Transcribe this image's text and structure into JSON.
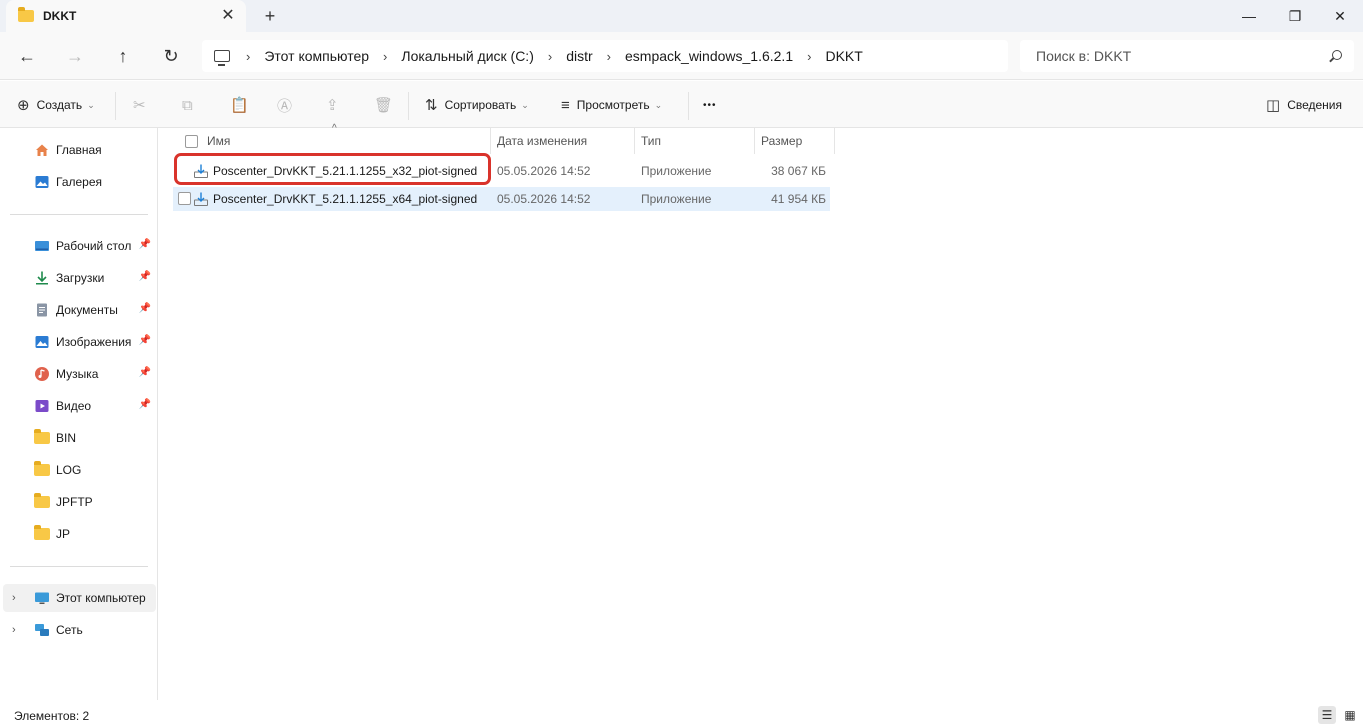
{
  "window": {
    "tab_title": "DKKT",
    "new_tab_glyph": "+",
    "close_tab_glyph": "✕",
    "minimize_glyph": "—",
    "restore_glyph": "❐",
    "close_glyph": "✕"
  },
  "address": {
    "back_glyph": "←",
    "forward_glyph": "→",
    "up_glyph": "↑",
    "refresh_glyph": "↻",
    "separator": "›",
    "crumbs": [
      "Этот компьютер",
      "Локальный диск (C:)",
      "distr",
      "esmpack_windows_1.6.2.1",
      "DKKT"
    ],
    "search_placeholder": "Поиск в: DKKT"
  },
  "toolbar": {
    "create_label": "Создать",
    "sort_label": "Сортировать",
    "view_label": "Просмотреть",
    "more_glyph": "•••",
    "details_label": "Сведения",
    "caret_glyph": "⌄"
  },
  "sidebar": {
    "top_items": [
      {
        "label": "Главная",
        "icon": "home-icon"
      },
      {
        "label": "Галерея",
        "icon": "gallery-icon"
      }
    ],
    "pinned_items": [
      {
        "label": "Рабочий стол",
        "icon": "desktop-icon",
        "pinned": true
      },
      {
        "label": "Загрузки",
        "icon": "downloads-icon",
        "pinned": true
      },
      {
        "label": "Документы",
        "icon": "documents-icon",
        "pinned": true
      },
      {
        "label": "Изображения",
        "icon": "pictures-icon",
        "pinned": true
      },
      {
        "label": "Музыка",
        "icon": "music-icon",
        "pinned": true
      },
      {
        "label": "Видео",
        "icon": "videos-icon",
        "pinned": true
      },
      {
        "label": "BIN",
        "icon": "folder-icon",
        "pinned": false
      },
      {
        "label": "LOG",
        "icon": "folder-icon",
        "pinned": false
      },
      {
        "label": "JPFTP",
        "icon": "folder-icon",
        "pinned": false
      },
      {
        "label": "JP",
        "icon": "folder-icon",
        "pinned": false
      }
    ],
    "bottom_items": [
      {
        "label": "Этот компьютер",
        "icon": "this-pc-icon",
        "selected": true
      },
      {
        "label": "Сеть",
        "icon": "network-icon",
        "selected": false
      }
    ],
    "chevron_glyph": "›",
    "pin_glyph": "📌"
  },
  "columns": {
    "name": "Имя",
    "date": "Дата изменения",
    "type": "Тип",
    "size": "Размер",
    "sort_glyph": "^"
  },
  "files": [
    {
      "name": "Poscenter_DrvKKT_5.21.1.1255_x32_piot-signed",
      "date": "05.05.2026 14:52",
      "type": "Приложение",
      "size": "38 067 КБ",
      "highlighted": true,
      "selected": false
    },
    {
      "name": "Poscenter_DrvKKT_5.21.1.1255_x64_piot-signed",
      "date": "05.05.2026 14:52",
      "type": "Приложение",
      "size": "41 954 КБ",
      "highlighted": false,
      "selected": true
    }
  ],
  "status": {
    "items_text": "Элементов: 2"
  },
  "colors": {
    "highlight_border": "#d9332b",
    "selection": "#e4f0fc",
    "folder": "#f8c846"
  }
}
